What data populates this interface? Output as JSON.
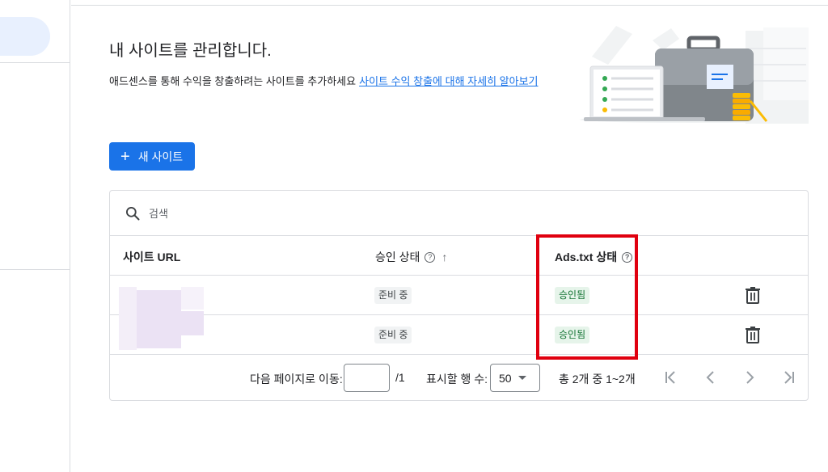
{
  "header": {
    "title": "내 사이트를 관리합니다.",
    "description": "애드센스를 통해 수익을 창출하려는 사이트를 추가하세요",
    "learn_more_link": "사이트 수익 창출에 대해 자세히 알아보기"
  },
  "toolbar": {
    "new_site_label": "새 사이트"
  },
  "search": {
    "placeholder": "검색",
    "value": ""
  },
  "table": {
    "columns": [
      "사이트 URL",
      "승인 상태",
      "Ads.txt 상태"
    ],
    "rows": [
      {
        "site_url": "",
        "approval_status": "준비 중",
        "ads_txt_status": "승인됨"
      },
      {
        "site_url": "",
        "approval_status": "준비 중",
        "ads_txt_status": "승인됨"
      }
    ]
  },
  "pagination": {
    "goto_label": "다음 페이지로 이동:",
    "goto_value": "",
    "total_pages": "/1",
    "rows_per_page_label": "표시할 행 수:",
    "rows_per_page_value": "50",
    "range_text": "총 2개 중 1~2개"
  },
  "colors": {
    "primary": "#1a73e8",
    "approved_bg": "#e6f4ea",
    "approved_text": "#137333",
    "highlight": "#e0000f"
  },
  "icons": {
    "search": "search-icon",
    "help": "help-circle-icon",
    "sort": "arrow-up-icon",
    "delete": "trash-icon",
    "first": "first-page-icon",
    "prev": "chevron-left-icon",
    "next": "chevron-right-icon",
    "last": "last-page-icon"
  }
}
